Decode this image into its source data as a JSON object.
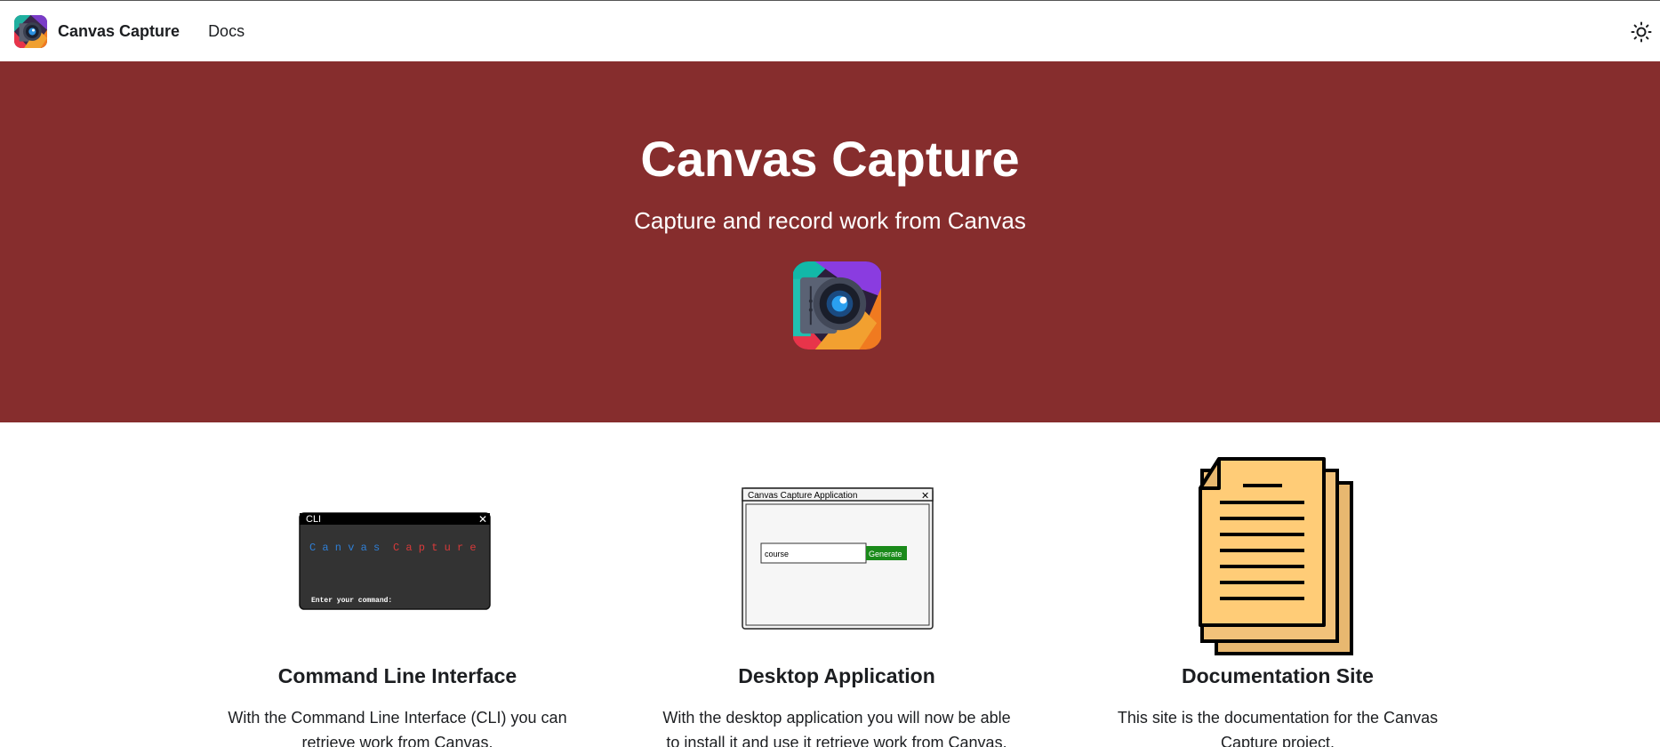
{
  "navbar": {
    "brand_title": "Canvas Capture",
    "docs_link": "Docs",
    "theme_icon": "sun-icon"
  },
  "hero": {
    "title": "Canvas Capture",
    "subtitle": "Capture and record work from Canvas"
  },
  "features": [
    {
      "title": "Command Line Interface",
      "description": "With the Command Line Interface (CLI) you can retrieve work from Canvas.",
      "illustration": {
        "window_title": "CLI",
        "close_glyph": "✕",
        "banner_left": "C a n v a s",
        "banner_right": "C a p t u r e",
        "prompt": "Enter your command:"
      }
    },
    {
      "title": "Desktop Application",
      "description": "With the desktop application you will now be able to install it and use it retrieve work from Canvas.",
      "illustration": {
        "window_title": "Canvas Capture Application",
        "close_glyph": "✕",
        "input_value": "course",
        "button_label": "Generate"
      }
    },
    {
      "title": "Documentation Site",
      "description": "This site is the documentation for the Canvas Capture project."
    }
  ],
  "colors": {
    "hero_bg": "#862d2d",
    "generate_button": "#1a8a1a",
    "banner_blue": "#2f7fd6",
    "banner_red": "#d83a3a",
    "doc_paper": "#ffcc77"
  }
}
